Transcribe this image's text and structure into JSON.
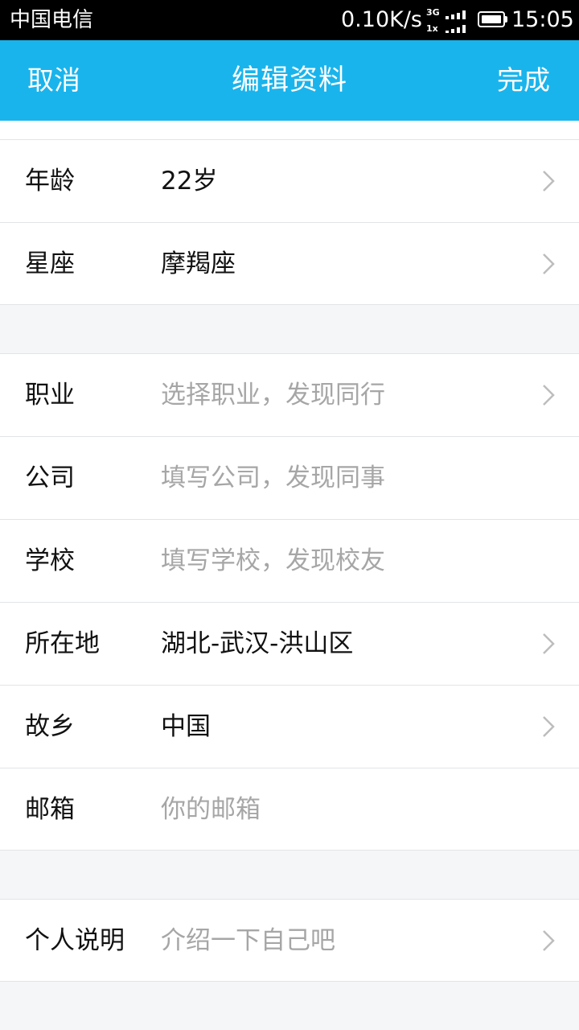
{
  "status_bar": {
    "carrier": "中国电信",
    "network_speed": "0.10K/s",
    "network_type_top": "3G",
    "network_type_bottom": "1x",
    "time": "15:05"
  },
  "header": {
    "cancel_label": "取消",
    "title": "编辑资料",
    "done_label": "完成",
    "color": "#1ab4ec"
  },
  "group1": [
    {
      "label": "年龄",
      "value": "22岁",
      "placeholder": false,
      "chevron": true
    },
    {
      "label": "星座",
      "value": "摩羯座",
      "placeholder": false,
      "chevron": true
    }
  ],
  "group2": [
    {
      "label": "职业",
      "value": "选择职业，发现同行",
      "placeholder": true,
      "chevron": true
    },
    {
      "label": "公司",
      "value": "填写公司，发现同事",
      "placeholder": true,
      "chevron": false
    },
    {
      "label": "学校",
      "value": "填写学校，发现校友",
      "placeholder": true,
      "chevron": false
    },
    {
      "label": "所在地",
      "value": "湖北-武汉-洪山区",
      "placeholder": false,
      "chevron": true
    },
    {
      "label": "故乡",
      "value": "中国",
      "placeholder": false,
      "chevron": true
    },
    {
      "label": "邮箱",
      "value": "你的邮箱",
      "placeholder": true,
      "chevron": false
    }
  ],
  "group3": [
    {
      "label": "个人说明",
      "value": "介绍一下自己吧",
      "placeholder": true,
      "chevron": true
    }
  ]
}
